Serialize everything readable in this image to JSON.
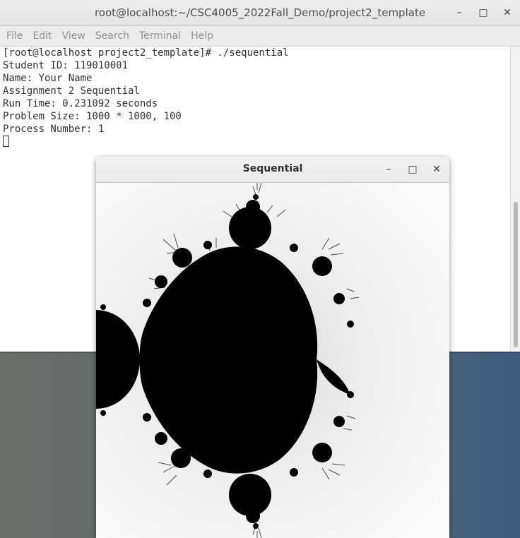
{
  "terminal": {
    "title": "root@localhost:~/CSC4005_2022Fall_Demo/project2_template",
    "controls": {
      "minimize": "–",
      "maximize": "□",
      "close": "✕"
    },
    "menu": [
      "File",
      "Edit",
      "View",
      "Search",
      "Terminal",
      "Help"
    ],
    "lines": [
      "[root@localhost project2_template]# ./sequential",
      "Student ID: 119010001",
      "Name: Your Name",
      "Assignment 2 Sequential",
      "Run Time: 0.231092 seconds",
      "Problem Size: 1000 * 1000, 100",
      "Process Number: 1"
    ]
  },
  "viewer": {
    "title": "Sequential",
    "controls": {
      "minimize": "–",
      "maximize": "□",
      "close": "✕"
    },
    "image": "mandelbrot-set"
  },
  "colors": {
    "desktop": "#4c6580",
    "terminal_text": "#2e3436",
    "menu_text": "#8e9192",
    "fractal_set": "#000000"
  }
}
